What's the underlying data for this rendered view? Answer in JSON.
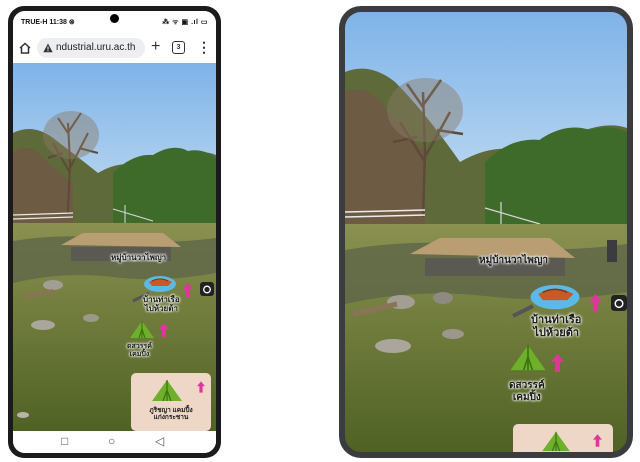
{
  "phone": {
    "status_bar": {
      "carrier_time": "TRUE-H 11:38 ⊗",
      "right_icons": "⁂ ᯤ ▣ .ıl ▭"
    },
    "browser": {
      "url": "ndustrial.uru.ac.th",
      "new_tab": "+",
      "tab_count": "3",
      "menu": "⋮"
    },
    "ar_labels": {
      "village_banner": "หมู่บ้านวาไพญา",
      "boat_pier": [
        "บ้านท่าเรือ",
        "ไปห้วยต้า"
      ],
      "campsite": [
        "ดสวรรค์",
        "เคมปิ้ง"
      ],
      "sign_title": [
        "ภูริชญา แคมปิ้ง",
        "แก่งกระชาน"
      ]
    },
    "nav": {
      "recents": "□",
      "home": "○",
      "back": "◁"
    }
  },
  "tablet": {
    "ar_labels": {
      "village_banner": "หมู่บ้านวาไพญา",
      "boat_pier": [
        "บ้านท่าเรือ",
        "ไปห้วยต้า"
      ],
      "campsite": [
        "ดสวรรค์",
        "เคมปิ้ง"
      ]
    }
  },
  "colors": {
    "sky": "#9cc3ea",
    "grass": "#6d7a38",
    "tent_green": "#6fb02a",
    "pin_magenta": "#e0359c",
    "boat_orange": "#c85a25",
    "water_blue": "#5ab9e6",
    "sign_beige": "#efd7c8"
  },
  "icons": [
    "home-icon",
    "warning-icon",
    "camera-icon",
    "tent-icon",
    "boat-icon",
    "pin-icon",
    "arrow-icon"
  ]
}
